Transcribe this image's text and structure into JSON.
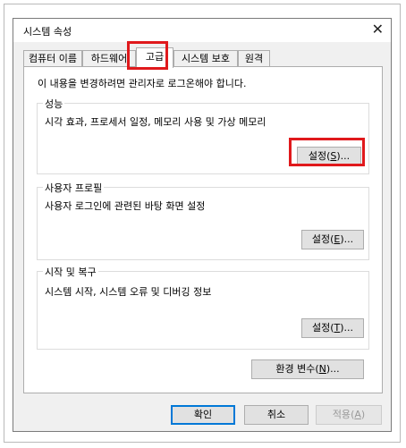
{
  "dialog": {
    "title": "시스템 속성"
  },
  "tabs": [
    {
      "label": "컴퓨터 이름"
    },
    {
      "label": "하드웨어"
    },
    {
      "label": "고급"
    },
    {
      "label": "시스템 보호"
    },
    {
      "label": "원격"
    }
  ],
  "panel": {
    "admin_note": "이 내용을 변경하려면 관리자로 로그온해야 합니다.",
    "performance": {
      "title": "성능",
      "desc": "시각 효과, 프로세서 일정, 메모리 사용 및 가상 메모리",
      "btn_label": "설정",
      "btn_key": "S"
    },
    "user_profile": {
      "title": "사용자 프로필",
      "desc": "사용자 로그인에 관련된 바탕 화면 설정",
      "btn_label": "설정",
      "btn_key": "E"
    },
    "startup": {
      "title": "시작 및 복구",
      "desc": "시스템 시작, 시스템 오류 및 디버깅 정보",
      "btn_label": "설정",
      "btn_key": "T"
    },
    "env_btn_label": "환경 변수",
    "env_btn_key": "N"
  },
  "footer": {
    "ok_label": "확인",
    "cancel_label": "취소",
    "apply_label": "적용",
    "apply_key": "A"
  },
  "colors": {
    "highlight": "#e0191c",
    "accent": "#0078d7"
  }
}
